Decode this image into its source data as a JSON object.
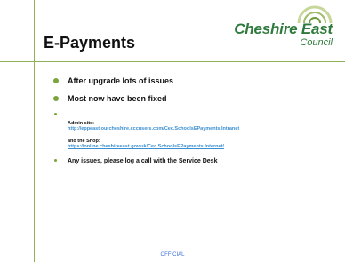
{
  "slide": {
    "title": "E-Payments",
    "logo": {
      "line1": "Cheshire East",
      "line2": "Council"
    },
    "bullets": [
      "After upgrade lots of issues",
      "Most now have been fixed"
    ],
    "admin_label": "Admin site:",
    "admin_url": "http://eppeast.ourcheshire.cccusers.com/Cec.SchoolsEPayments.Intranet",
    "shop_label": "and the Shop:",
    "shop_url": "https://online.cheshireeast.gov.uk/Cec.SchoolsEPayments.Internet/",
    "last_bullet": "Any issues, please log a call with the Service Desk",
    "footer": "OFFICIAL"
  },
  "colors": {
    "accent": "#7aa43c",
    "line": "#8fb15a",
    "logo": "#2e7a3c",
    "link": "#3b8fd1"
  }
}
